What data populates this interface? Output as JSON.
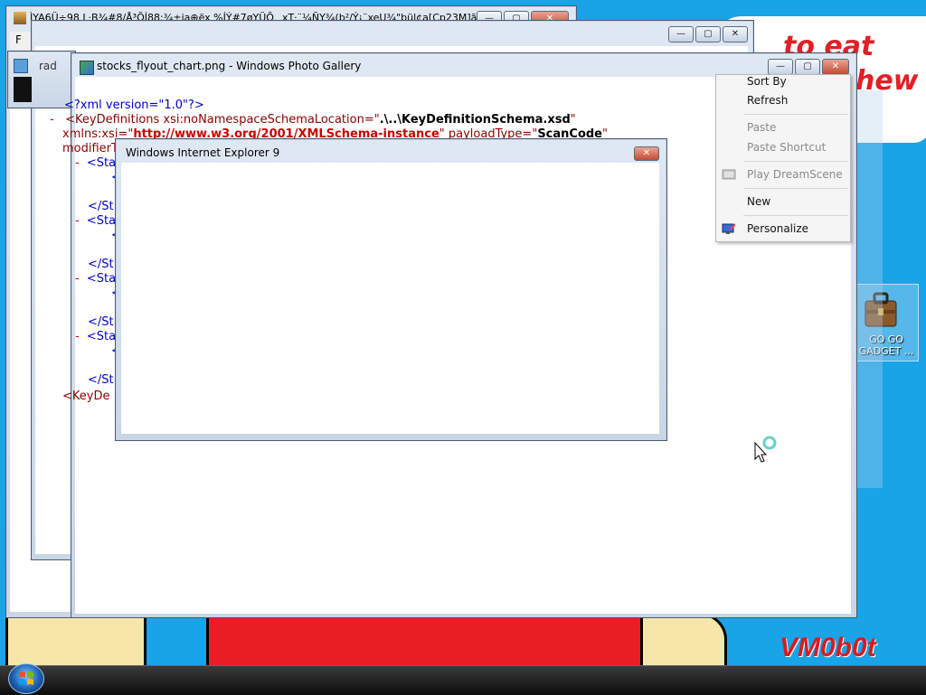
{
  "desktop": {
    "wallpaper_text_1": "to eat shit",
    "wallpaper_text_2": "hew",
    "signature": "VM0b0t",
    "icon_label": "GO GO GADGET ..."
  },
  "bg_window_1": {
    "title": "ÌYA6Ü÷98 L·B¾#8/Å³ÕÍ88:¾±ja⊕ëx %ÍÝ#7øYÜÕ¸ xT·¨¼ÑY¾(b²/Ý¡¨xeU¾\"bül¢a[Cp23M]ãlczeü",
    "menu_initial": "F"
  },
  "bg_window_2": {
    "tab_label": "rad"
  },
  "photo_gallery": {
    "title": "stocks_flyout_chart.png - Windows Photo Gallery",
    "xml_lines": {
      "l1": "<?xml version=\"1.0\"?>",
      "l2_minus": "-",
      "l2_tag": "<KeyDefinitions xsi:noNamespaceSchemaLocation=\"",
      "l2_val": ".\\..\\KeyDefinitionSchema.xsd",
      "l2_end": "\"",
      "l3_attr": "xmlns:xsi=\"",
      "l3_link": "http://www.w3.org/2001/XMLSchema-instance",
      "l3_mid": "\" payloadType=\"",
      "l3_val": "ScanCode",
      "l3_end": "\"",
      "l4": "modifierT",
      "sta_open": "<Sta",
      "st_close": "</St",
      "lt": "<",
      "tail": "<KeyDe",
      "minus": "-"
    }
  },
  "ie_dialog": {
    "title": "Windows Internet Explorer 9"
  },
  "context_menu": {
    "items": [
      {
        "label": "Sort By"
      },
      {
        "label": "Refresh"
      },
      {
        "label": "Paste"
      },
      {
        "label": "Paste Shortcut"
      },
      {
        "label": "Play DreamScene"
      },
      {
        "label": "New"
      },
      {
        "label": "Personalize"
      }
    ]
  },
  "window_controls": {
    "minimize": "—",
    "maximize": "▢",
    "close": "✕"
  }
}
